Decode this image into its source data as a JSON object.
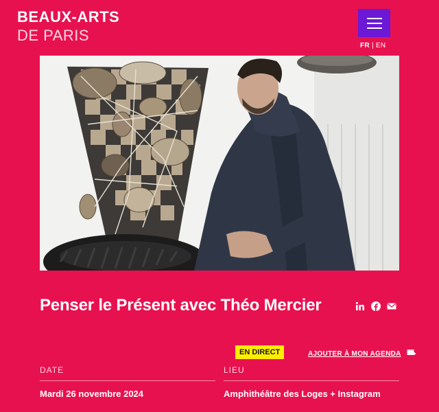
{
  "header": {
    "logo_line1": "BEAUX-ARTS",
    "logo_line2": "DE PARIS",
    "menu_icon": "hamburger-menu-icon",
    "lang_active": "FR",
    "lang_separator": "|",
    "lang_other": "EN"
  },
  "hero": {
    "image_alt": "Photo"
  },
  "event": {
    "title": "Penser le Présent avec Théo Mercier",
    "share_icons": [
      "linkedin-icon",
      "facebook-icon",
      "mail-icon"
    ],
    "live_badge": "EN DIRECT",
    "add_to_agenda": "AJOUTER À MON AGENDA",
    "agenda_icon": "calendar-add-icon",
    "date_label": "DATE",
    "date_value": "Mardi 26 novembre 2024",
    "place_label": "LIEU",
    "place_value": "Amphithéâtre des Loges + Instagram"
  },
  "colors": {
    "background": "#e8114f",
    "menu_button": "#6b19d6",
    "badge": "#ffee00"
  }
}
